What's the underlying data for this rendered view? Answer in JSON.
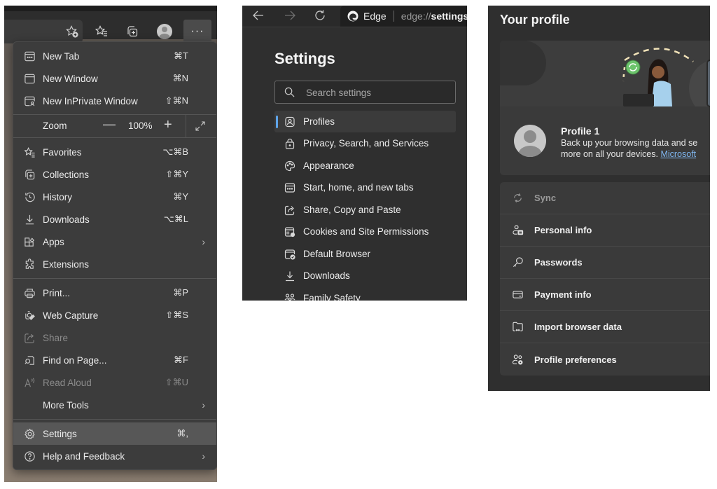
{
  "menu_panel": {
    "toolbar": {
      "icons": [
        "add-favorite-icon",
        "favorites-icon",
        "collections-icon",
        "profile-avatar",
        "more-icon"
      ],
      "more_label": "···"
    },
    "items": [
      {
        "label": "New Tab",
        "shortcut": "⌘T",
        "icon": "new-tab-icon"
      },
      {
        "label": "New Window",
        "shortcut": "⌘N",
        "icon": "new-window-icon"
      },
      {
        "label": "New InPrivate Window",
        "shortcut": "⇧⌘N",
        "icon": "inprivate-icon"
      },
      {
        "label": "Favorites",
        "shortcut": "⌥⌘B",
        "icon": "favorites-icon"
      },
      {
        "label": "Collections",
        "shortcut": "⇧⌘Y",
        "icon": "collections-icon"
      },
      {
        "label": "History",
        "shortcut": "⌘Y",
        "icon": "history-icon"
      },
      {
        "label": "Downloads",
        "shortcut": "⌥⌘L",
        "icon": "download-icon"
      },
      {
        "label": "Apps",
        "shortcut": "",
        "icon": "apps-icon",
        "submenu": true
      },
      {
        "label": "Extensions",
        "shortcut": "",
        "icon": "extensions-icon"
      },
      {
        "label": "Print...",
        "shortcut": "⌘P",
        "icon": "print-icon"
      },
      {
        "label": "Web Capture",
        "shortcut": "⇧⌘S",
        "icon": "web-capture-icon"
      },
      {
        "label": "Share",
        "shortcut": "",
        "icon": "share-icon",
        "disabled": true
      },
      {
        "label": "Find on Page...",
        "shortcut": "⌘F",
        "icon": "find-icon"
      },
      {
        "label": "Read Aloud",
        "shortcut": "⇧⌘U",
        "icon": "read-aloud-icon",
        "disabled": true
      },
      {
        "label": "More Tools",
        "shortcut": "",
        "icon": "",
        "submenu": true
      },
      {
        "label": "Settings",
        "shortcut": "⌘,",
        "icon": "gear-icon",
        "highlighted": true
      },
      {
        "label": "Help and Feedback",
        "shortcut": "",
        "icon": "help-icon",
        "submenu": true
      }
    ],
    "zoom": {
      "label": "Zoom",
      "minus": "—",
      "value": "100%",
      "plus": "+"
    },
    "chevron": "›"
  },
  "settings_panel": {
    "address": {
      "brand": "Edge",
      "url_prefix": "edge://",
      "url_bold": "settings"
    },
    "title": "Settings",
    "search_placeholder": "Search settings",
    "nav": [
      {
        "label": "Profiles",
        "icon": "profile-icon",
        "active": true
      },
      {
        "label": "Privacy, Search, and Services",
        "icon": "lock-icon"
      },
      {
        "label": "Appearance",
        "icon": "palette-icon"
      },
      {
        "label": "Start, home, and new tabs",
        "icon": "new-tab-icon"
      },
      {
        "label": "Share, Copy and Paste",
        "icon": "share-icon"
      },
      {
        "label": "Cookies and Site Permissions",
        "icon": "cookies-icon"
      },
      {
        "label": "Default Browser",
        "icon": "default-browser-icon"
      },
      {
        "label": "Downloads",
        "icon": "download-icon"
      },
      {
        "label": "Family Safety",
        "icon": "family-icon"
      }
    ],
    "accent_color": "#5ea4e8"
  },
  "profile_panel": {
    "title": "Your profile",
    "profile_name": "Profile 1",
    "description_line1": "Back up your browsing data and se",
    "description_line2": "more on all your devices. ",
    "link_text": "Microsoft",
    "rows": [
      {
        "label": "Sync",
        "icon": "sync-icon",
        "disabled": true
      },
      {
        "label": "Personal info",
        "icon": "personal-info-icon"
      },
      {
        "label": "Passwords",
        "icon": "key-icon"
      },
      {
        "label": "Payment info",
        "icon": "credit-card-icon"
      },
      {
        "label": "Import browser data",
        "icon": "import-icon"
      },
      {
        "label": "Profile preferences",
        "icon": "profile-preferences-icon"
      }
    ],
    "link_color": "#7fb6ef",
    "sync_badge_color": "#6cc36c"
  }
}
